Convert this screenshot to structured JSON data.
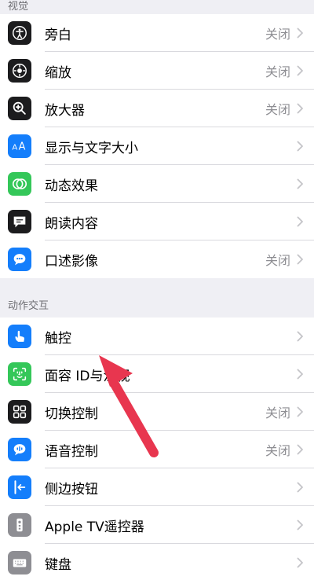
{
  "sections": {
    "vision": {
      "header": "视觉",
      "items": [
        {
          "label": "旁白",
          "value": "关闭",
          "icon": "voiceover-icon",
          "color": "#1c1c1e"
        },
        {
          "label": "缩放",
          "value": "关闭",
          "icon": "zoom-icon",
          "color": "#1c1c1e"
        },
        {
          "label": "放大器",
          "value": "关闭",
          "icon": "magnifier-icon",
          "color": "#1c1c1e"
        },
        {
          "label": "显示与文字大小",
          "value": "",
          "icon": "text-size-icon",
          "color": "#147efb"
        },
        {
          "label": "动态效果",
          "value": "",
          "icon": "motion-icon",
          "color": "#34c759"
        },
        {
          "label": "朗读内容",
          "value": "",
          "icon": "speech-bubble-icon",
          "color": "#1c1c1e"
        },
        {
          "label": "口述影像",
          "value": "关闭",
          "icon": "audio-description-icon",
          "color": "#147efb"
        }
      ]
    },
    "interaction": {
      "header": "动作交互",
      "items": [
        {
          "label": "触控",
          "value": "",
          "icon": "hand-touch-icon",
          "color": "#147efb"
        },
        {
          "label": "面容 ID与注视",
          "value": "",
          "icon": "face-id-icon",
          "color": "#34c759"
        },
        {
          "label": "切换控制",
          "value": "关闭",
          "icon": "switch-grid-icon",
          "color": "#1c1c1e"
        },
        {
          "label": "语音控制",
          "value": "关闭",
          "icon": "voice-control-icon",
          "color": "#147efb"
        },
        {
          "label": "侧边按钮",
          "value": "",
          "icon": "side-button-icon",
          "color": "#147efb"
        },
        {
          "label": "Apple TV遥控器",
          "value": "",
          "icon": "remote-icon",
          "color": "#8e8e93"
        },
        {
          "label": "键盘",
          "value": "",
          "icon": "keyboard-icon",
          "color": "#8e8e93"
        }
      ]
    }
  },
  "annotation": {
    "arrow_color": "#e8364f"
  }
}
